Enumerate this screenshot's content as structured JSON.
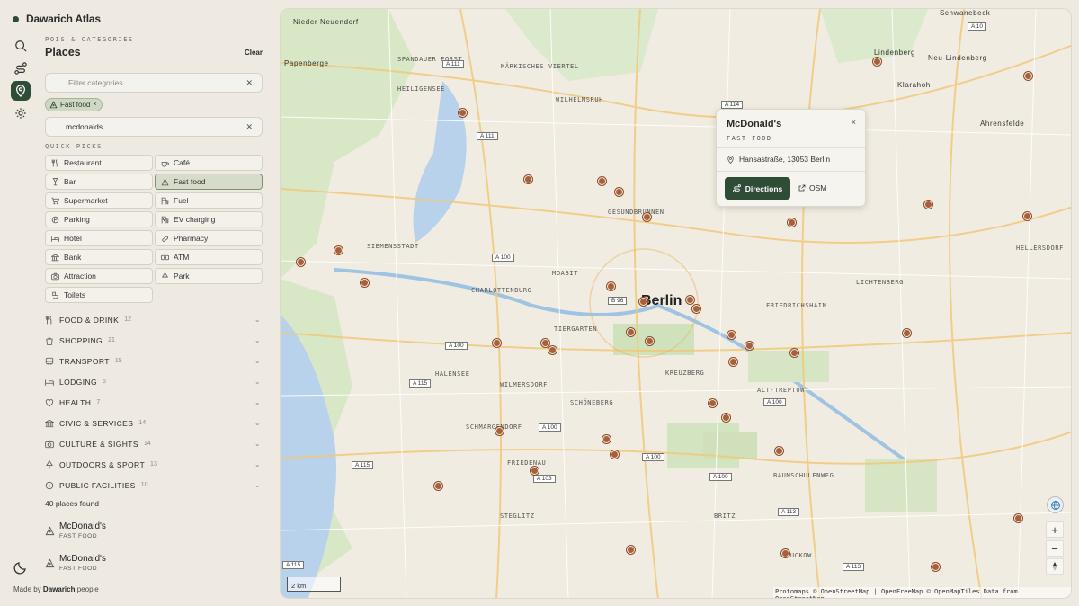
{
  "app": {
    "name": "Dawarich Atlas",
    "footer_prefix": "Made by",
    "footer_brand": "Dawarich",
    "footer_suffix": "people"
  },
  "rail": [
    {
      "icon": "search-icon"
    },
    {
      "icon": "route-icon"
    },
    {
      "icon": "map-pin-icon",
      "active": true
    },
    {
      "icon": "gear-icon"
    }
  ],
  "panel": {
    "eyebrow": "POIS & CATEGORIES",
    "title": "Places",
    "clear_label": "Clear",
    "filter_placeholder": "Filter categories...",
    "chip_label": "Fast food",
    "search_value": "mcdonalds",
    "quick_picks_label": "QUICK PICKS"
  },
  "quick_picks": [
    {
      "label": "Restaurant",
      "icon": "utensils-icon"
    },
    {
      "label": "Café",
      "icon": "coffee-icon"
    },
    {
      "label": "Bar",
      "icon": "glass-icon"
    },
    {
      "label": "Fast food",
      "icon": "pizza-icon",
      "selected": true
    },
    {
      "label": "Supermarket",
      "icon": "cart-icon"
    },
    {
      "label": "Fuel",
      "icon": "fuel-icon"
    },
    {
      "label": "Parking",
      "icon": "parking-icon"
    },
    {
      "label": "EV charging",
      "icon": "ev-icon"
    },
    {
      "label": "Hotel",
      "icon": "bed-icon"
    },
    {
      "label": "Pharmacy",
      "icon": "pill-icon"
    },
    {
      "label": "Bank",
      "icon": "bank-icon"
    },
    {
      "label": "ATM",
      "icon": "cash-icon"
    },
    {
      "label": "Attraction",
      "icon": "camera-icon"
    },
    {
      "label": "Park",
      "icon": "tree-icon"
    },
    {
      "label": "Toilets",
      "icon": "toilet-icon"
    }
  ],
  "categories": [
    {
      "label": "FOOD & DRINK",
      "count": "12"
    },
    {
      "label": "SHOPPING",
      "count": "21"
    },
    {
      "label": "TRANSPORT",
      "count": "15"
    },
    {
      "label": "LODGING",
      "count": "6"
    },
    {
      "label": "HEALTH",
      "count": "7"
    },
    {
      "label": "CIVIC & SERVICES",
      "count": "14"
    },
    {
      "label": "CULTURE & SIGHTS",
      "count": "14"
    },
    {
      "label": "OUTDOORS & SPORT",
      "count": "13"
    },
    {
      "label": "PUBLIC FACILITIES",
      "count": "10"
    }
  ],
  "results_count": "40 places found",
  "results": [
    {
      "name": "McDonald's",
      "type": "FAST FOOD"
    },
    {
      "name": "McDonald's",
      "type": "FAST FOOD"
    }
  ],
  "popup": {
    "name": "McDonald's",
    "type": "FAST FOOD",
    "address": "Hansastraße, 13053 Berlin",
    "directions_label": "Directions",
    "osm_label": "OSM",
    "close": "×"
  },
  "map": {
    "city_label": "Berlin",
    "scale_label": "2 km",
    "attribution": "Protomaps © OpenStreetMap | OpenFreeMap © OpenMapTiles Data from OpenStreetMap",
    "place_labels": [
      "Nieder Neuendorf",
      "Papenberge",
      "SPANDAUER FORST",
      "HEILIGENSEE",
      "MÄRKISCHES VIERTEL",
      "WILHELMSRUH",
      "Schwanebeck",
      "Lindenberg",
      "Neu-Lindenberg",
      "Klarahoh",
      "Ahrensfelde",
      "GESUNDBRUNNEN",
      "SIEMENSSTADT",
      "MOABIT",
      "CHARLOTTENBURG",
      "TIERGARTEN",
      "FRIEDRICHSHAIN",
      "LICHTENBERG",
      "HELLERSDORF",
      "KREUZBERG",
      "HALENSEE",
      "WILMERSDORF",
      "SCHMARGENDORF",
      "SCHÖNEBERG",
      "ALT-TREPTOW",
      "BAUMSCHULENWEG",
      "FRIEDENAU",
      "STEGLITZ",
      "BRITZ",
      "BUCKOW"
    ],
    "road_shields": [
      "A 111",
      "A 111",
      "A 114",
      "A 10",
      "A 100",
      "B 96",
      "A 100",
      "A 115",
      "A 100",
      "A 100",
      "A 100",
      "A 103",
      "A 100",
      "A 115",
      "A 113",
      "A 113",
      "A 115"
    ]
  }
}
